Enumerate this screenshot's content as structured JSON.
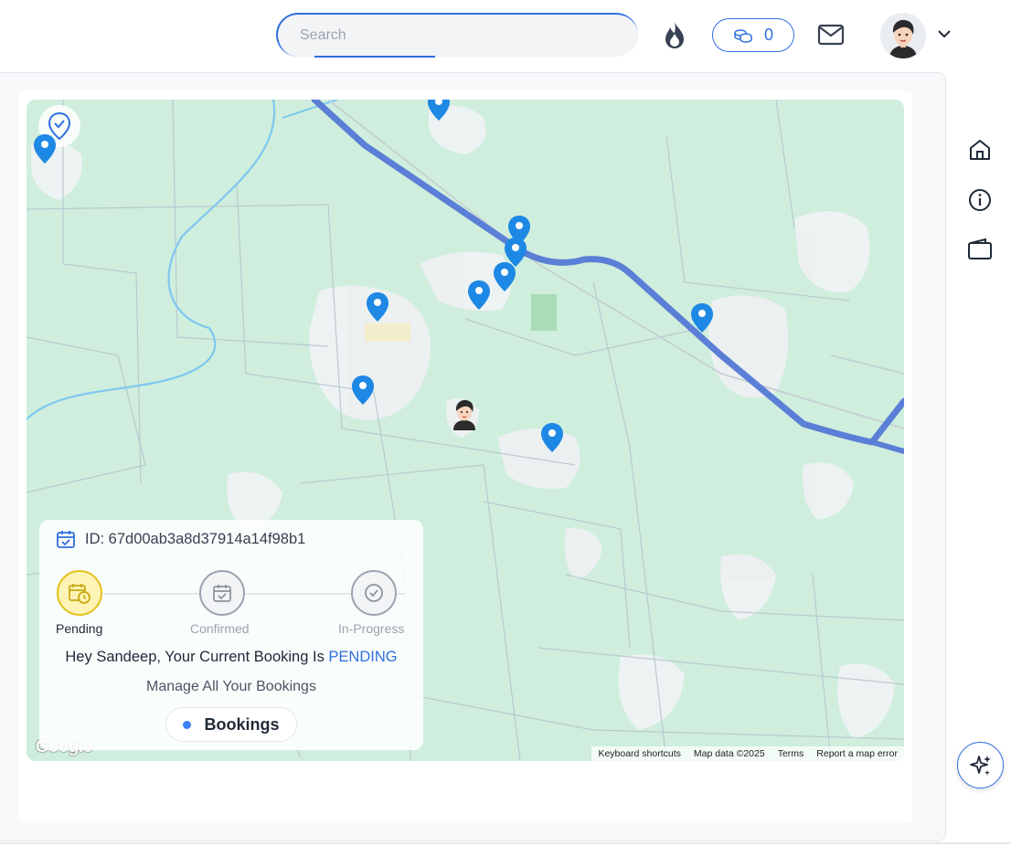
{
  "header": {
    "search_placeholder": "Search",
    "coins_count": "0",
    "icons": {
      "streak": "flame-icon",
      "coins": "coins-icon",
      "messages": "mail-icon",
      "profile_menu": "chevron-down-icon"
    }
  },
  "map": {
    "attribution": {
      "keyboard_shortcuts": "Keyboard shortcuts",
      "map_data": "Map data ©2025",
      "terms": "Terms",
      "report": "Report a map error"
    },
    "logo_text": "Google",
    "pin_color": "#1e88e5"
  },
  "booking": {
    "id_label": "ID: 67d00ab3a8d37914a14f98b1",
    "steps": [
      {
        "label": "Pending",
        "active": true
      },
      {
        "label": "Confirmed",
        "active": false
      },
      {
        "label": "In-Progress",
        "active": false
      }
    ],
    "message_prefix": "Hey Sandeep, Your Current Booking Is ",
    "status": "PENDING",
    "manage_text": "Manage All Your Bookings",
    "bookings_button": "Bookings"
  },
  "sidebar": {
    "items": [
      {
        "name": "home",
        "icon": "home-icon"
      },
      {
        "name": "info",
        "icon": "info-icon"
      },
      {
        "name": "wallet",
        "icon": "wallet-icon"
      }
    ],
    "assistant_icon": "sparkles-icon"
  },
  "colors": {
    "accent": "#2f6fe0",
    "pending": "#e3c21b",
    "map_land": "#cfeedd",
    "road_highway": "#5b7fd6"
  }
}
